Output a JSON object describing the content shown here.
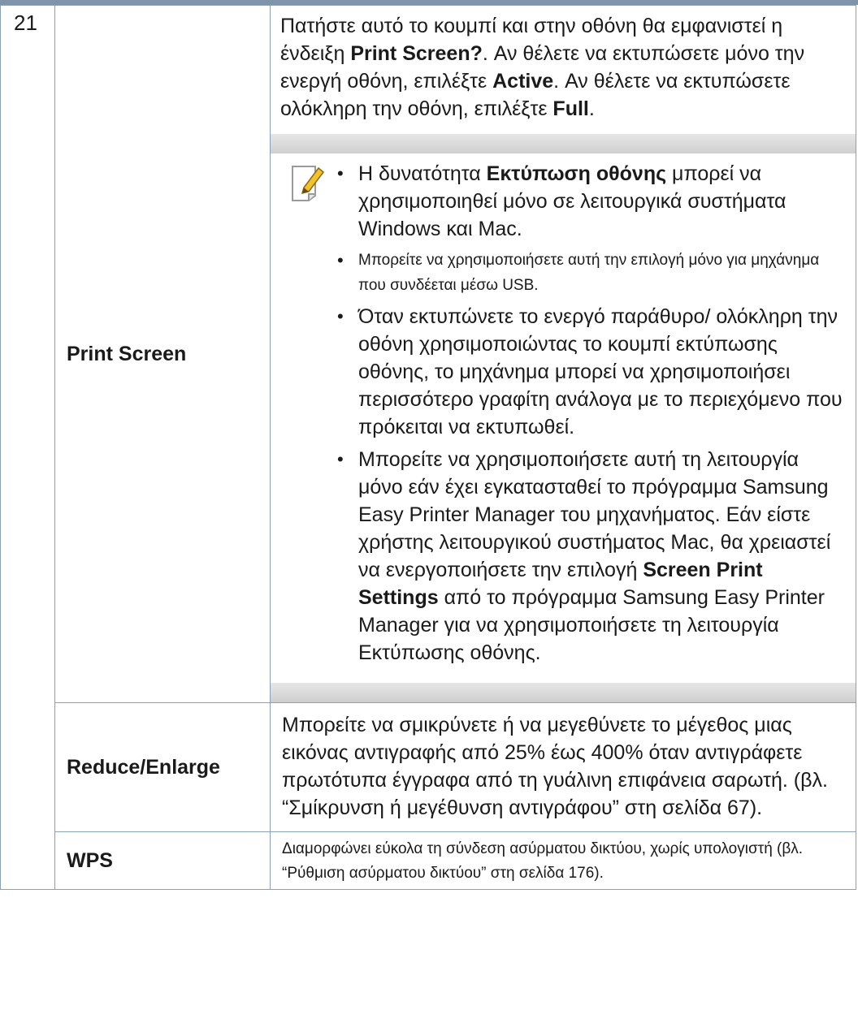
{
  "row_number": "21",
  "print_screen": {
    "name": "Print Screen",
    "desc_1": "Πατήστε αυτό το κουμπί και στην οθόνη θα εμφανιστεί η ένδειξη ",
    "desc_b1": "Print Screen?",
    "desc_2": ". Αν θέλετε να εκτυπώσετε μόνο την ενεργή οθόνη, επιλέξτε ",
    "desc_b2": "Active",
    "desc_3": ". Αν θέλετε να εκτυπώσετε ολόκληρη την οθόνη, επιλέξτε ",
    "desc_b3": "Full",
    "desc_4": ".",
    "note": {
      "icon": "note-pencil-icon",
      "b1_pre": "Η δυνατότητα ",
      "b1_bold": "Εκτύπωση οθόνης",
      "b1_post": " μπορεί να χρησιμοποιηθεί μόνο σε λειτουργικά συστήματα Windows και Mac.",
      "b2": "Μπορείτε να χρησιμοποιήσετε αυτή την επιλογή μόνο για μηχάνημα που συνδέεται μέσω USB.",
      "b3": "Όταν εκτυπώνετε το ενεργό παράθυρο/ ολόκληρη την οθόνη χρησιμοποιώντας το κουμπί εκτύπωσης οθόνης, το μηχάνημα μπορεί να χρησιμοποιήσει περισσότερο γραφίτη ανάλογα με το περιεχόμενο που πρόκειται να εκτυπωθεί.",
      "b4_pre": "Μπορείτε να χρησιμοποιήσετε αυτή τη λειτουργία μόνο εάν έχει εγκατασταθεί το πρόγραμμα Samsung Easy Printer Manager του μηχανήματος. Εάν είστε χρήστης λειτουργικού συστήματος Mac, θα χρειαστεί να ενεργοποιήσετε την επιλογή ",
      "b4_bold": "Screen Print Settings",
      "b4_post": " από το πρόγραμμα Samsung Easy Printer Manager για να χρησιμοποιήσετε τη λειτουργία Εκτύπωσης οθόνης."
    }
  },
  "reduce_enlarge": {
    "name": "Reduce/Enlarge",
    "desc": "Μπορείτε να σμικρύνετε ή να μεγεθύνετε το μέγεθος μιας εικόνας αντιγραφής από 25% έως 400% όταν αντιγράφετε πρωτότυπα έγγραφα από τη γυάλινη επιφάνεια σαρωτή. (βλ. “Σμίκρυνση ή μεγέθυνση αντιγράφου” στη σελίδα 67)."
  },
  "wps": {
    "name": "WPS",
    "desc": "Διαμορφώνει εύκολα τη σύνδεση ασύρματου δικτύου, χωρίς υπολογιστή (βλ. “Ρύθμιση ασύρματου δικτύου” στη σελίδα 176)."
  }
}
